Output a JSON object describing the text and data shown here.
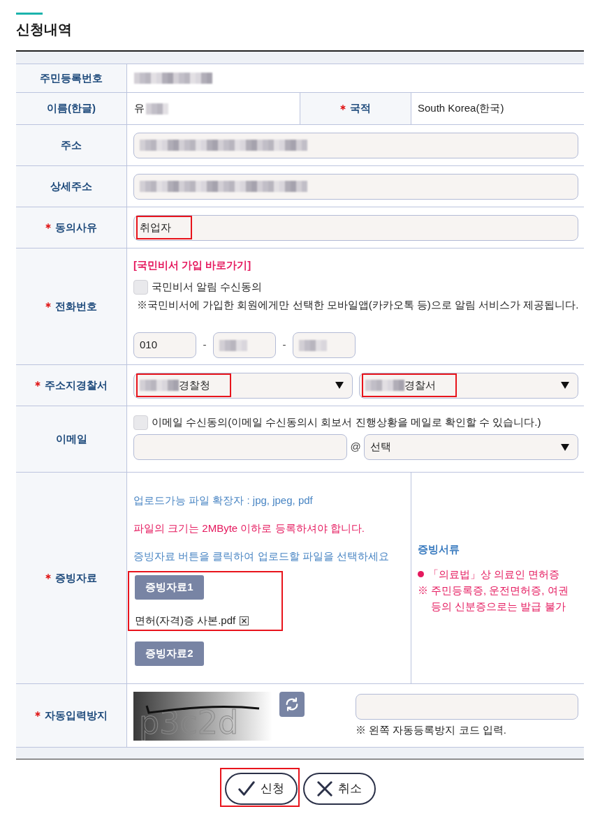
{
  "section": {
    "title": "신청내역"
  },
  "form": {
    "rows": [
      {
        "kind": "text",
        "label": "주민등록번호",
        "required": false,
        "value": {
          "blurred_before": true
        }
      },
      {
        "kind": "pair",
        "cells": [
          {
            "label": "이름(한글)",
            "required": false,
            "value": {
              "text": "유",
              "blurred_after": true
            }
          },
          {
            "label": "국적",
            "required": true,
            "value": {
              "text": "South Korea(한국)"
            }
          }
        ]
      },
      {
        "kind": "input",
        "label": "주소",
        "required": false,
        "field": {
          "blurred_before": true,
          "highlighted": false
        }
      },
      {
        "kind": "input",
        "label": "상세주소",
        "required": false,
        "field": {
          "blurred_before": true,
          "highlighted": false
        }
      },
      {
        "kind": "input",
        "label": "동의사유",
        "required": true,
        "field": {
          "text": "취업자",
          "highlighted": true
        }
      },
      {
        "kind": "phone",
        "label": "전화번호",
        "required": true,
        "link": "[국민비서 가입 바로가기]",
        "consent": {
          "label": "국민비서 알림 수신동의",
          "checked": false
        },
        "note": "※국민비서에 가입한 회원에게만 선택한 모바일앱(카카오톡 등)으로 알림 서비스가 제공됩니다.",
        "parts": [
          {
            "text": "010"
          },
          {
            "blurred_before": true
          },
          {
            "blurred_before": true
          }
        ],
        "separators": [
          "-",
          "-"
        ]
      },
      {
        "kind": "selects",
        "label": "주소지경찰서",
        "required": true,
        "selects": [
          {
            "text": "경찰청",
            "blurred_before": true,
            "highlighted": true
          },
          {
            "text": "경찰서",
            "blurred_before": true,
            "highlighted": true
          }
        ]
      },
      {
        "kind": "email",
        "label": "이메일",
        "required": false,
        "consent": {
          "label": "이메일 수신동의(이메일 수신동의시 회보서 진행상황을 메일로 확인할 수 있습니다.)",
          "checked": false
        },
        "at": "@",
        "domain": {
          "text": "선택"
        }
      },
      {
        "kind": "upload",
        "label": "증빙자료",
        "required": true,
        "notes": [
          {
            "kind": "info",
            "text": "업로드가능 파일 확장자 : jpg, jpeg, pdf"
          },
          {
            "kind": "warning",
            "text": "파일의 크기는 2MByte 이하로 등록하셔야 합니다."
          },
          {
            "kind": "info",
            "text": "증빙자료 버튼을 클릭하여 업로드할 파일을 선택하세요"
          }
        ],
        "slots": [
          {
            "button": "증빙자료1",
            "file": "면허(자격)증 사본.pdf",
            "highlighted": true
          },
          {
            "button": "증빙자료2",
            "highlighted": false
          }
        ],
        "side": {
          "title": "증빙서류",
          "items": [
            {
              "kind": "bullet",
              "text": "「의료법」상 의료인 면허증"
            },
            {
              "kind": "note",
              "mark": "※",
              "text": "주민등록증, 운전면허증, 여권 등의 신분증으로는 발급 불가"
            }
          ]
        }
      },
      {
        "kind": "captcha",
        "label": "자동입력방지",
        "required": true,
        "captcha_text": "p3c2d",
        "note": "※ 왼쪽 자동등록방지 코드 입력."
      }
    ]
  },
  "actions": [
    {
      "kind": "confirm",
      "label": "신청",
      "highlighted": true
    },
    {
      "kind": "cancel",
      "label": "취소",
      "highlighted": false
    }
  ]
}
